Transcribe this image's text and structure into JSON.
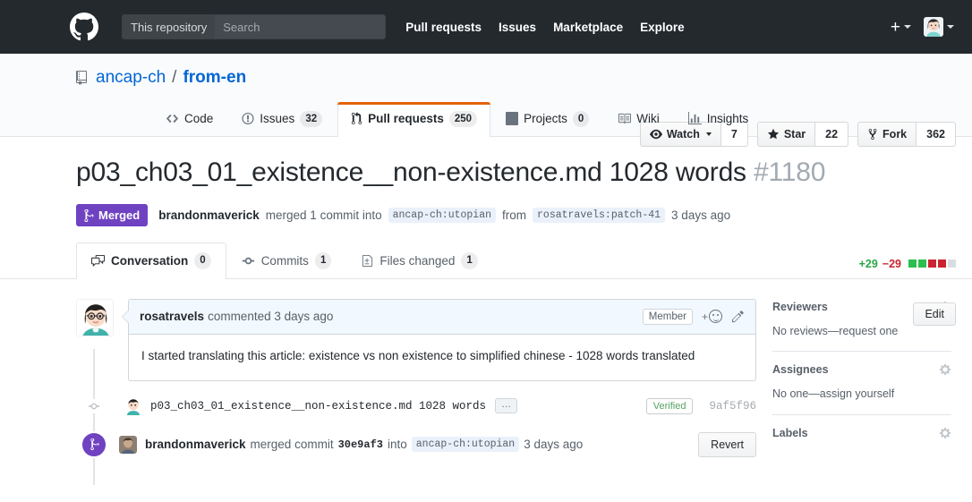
{
  "topbar": {
    "logo_icon": "github-mark-icon",
    "search_scope": "This repository",
    "search_placeholder": "Search",
    "search_value": "",
    "nav": [
      {
        "label": "Pull requests"
      },
      {
        "label": "Issues"
      },
      {
        "label": "Marketplace"
      },
      {
        "label": "Explore"
      }
    ],
    "plus_icon": "plus-icon",
    "avatar_icon": "user-avatar-icon"
  },
  "repo": {
    "icon": "repo-book-icon",
    "owner": "ancap-ch",
    "separator": "/",
    "name": "from-en",
    "actions": [
      {
        "label": "Watch",
        "count": "7",
        "icon": "eye-icon",
        "has_caret": true
      },
      {
        "label": "Star",
        "count": "22",
        "icon": "star-icon",
        "has_caret": false
      },
      {
        "label": "Fork",
        "count": "362",
        "icon": "fork-icon",
        "has_caret": false
      }
    ],
    "nav": [
      {
        "label": "Code",
        "count": "",
        "icon": "code-icon",
        "selected": false
      },
      {
        "label": "Issues",
        "count": "32",
        "icon": "issue-opened-icon",
        "selected": false
      },
      {
        "label": "Pull requests",
        "count": "250",
        "icon": "git-pull-request-icon",
        "selected": true
      },
      {
        "label": "Projects",
        "count": "0",
        "icon": "project-board-icon",
        "selected": false
      },
      {
        "label": "Wiki",
        "count": "",
        "icon": "book-icon",
        "selected": false
      },
      {
        "label": "Insights",
        "count": "",
        "icon": "graph-icon",
        "selected": false
      }
    ]
  },
  "pull_request": {
    "title": "p03_ch03_01_existence__non-existence.md 1028 words",
    "number": "#1180",
    "edit_label": "Edit",
    "state": "Merged",
    "state_icon": "git-merge-icon",
    "state_color": "#6f42c1",
    "merged_by": "brandonmaverick",
    "merged_action": "merged 1 commit into",
    "base_branch": "ancap-ch:utopian",
    "from_word": "from",
    "head_branch": "rosatravels:patch-41",
    "merged_when": "3 days ago",
    "tabs": [
      {
        "label": "Conversation",
        "count": "0",
        "icon": "comment-discussion-icon",
        "selected": true
      },
      {
        "label": "Commits",
        "count": "1",
        "icon": "git-commit-icon",
        "selected": false
      },
      {
        "label": "Files changed",
        "count": "1",
        "icon": "diff-file-icon",
        "selected": false
      }
    ],
    "diffstat": {
      "additions": "+29",
      "deletions": "−29",
      "add_color": "#28a745",
      "del_color": "#cb2431",
      "neutral_color": "#d1d5da",
      "blocks": [
        "add",
        "add",
        "del",
        "del",
        "neutral"
      ]
    }
  },
  "comment": {
    "author": "rosatravels",
    "action": "commented",
    "when": "3 days ago",
    "member_badge": "Member",
    "reaction_icon": "add-reaction-icon",
    "edit_icon": "pencil-icon",
    "body": "I started translating this article: existence vs non existence to simplified chinese - 1028 words translated"
  },
  "timeline": [
    {
      "type": "commit",
      "icon": "git-commit-dot-icon",
      "avatar": "rosatravels-avatar",
      "message": "p03_ch03_01_existence__non-existence.md 1028 words",
      "ellipsis_label": "…",
      "verified_label": "Verified",
      "sha": "9af5f96"
    },
    {
      "type": "merged",
      "icon": "git-merge-icon",
      "avatar": "brandonmaverick-avatar",
      "user": "brandonmaverick",
      "action": "merged commit",
      "commit_sha": "30e9af3",
      "into_word": "into",
      "branch": "ancap-ch:utopian",
      "when": "3 days ago",
      "revert_label": "Revert"
    }
  ],
  "sidebar": {
    "sections": [
      {
        "title": "Reviewers",
        "gear_icon": "gear-icon",
        "text": "No reviews—request one"
      },
      {
        "title": "Assignees",
        "gear_icon": "gear-icon",
        "text": "No one—assign yourself"
      },
      {
        "title": "Labels",
        "gear_icon": "gear-icon",
        "text": ""
      }
    ]
  }
}
